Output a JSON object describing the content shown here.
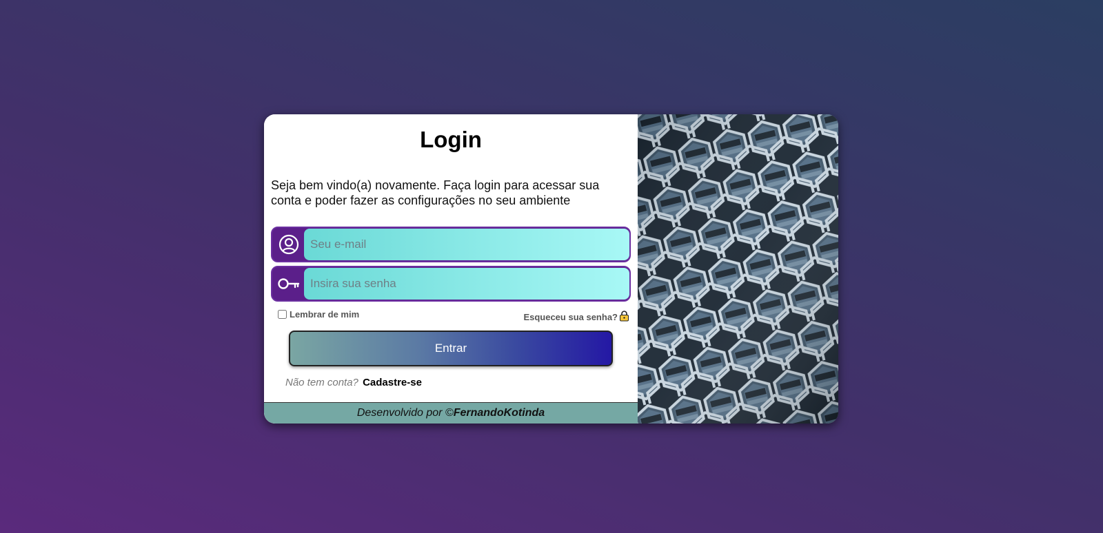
{
  "login": {
    "title": "Login",
    "subtitle": "Seja bem vindo(a) novamente. Faça login para acessar sua conta e poder fazer as configurações no seu ambiente",
    "email_placeholder": "Seu e-mail",
    "password_placeholder": "Insira sua senha",
    "remember_label": "Lembrar de mim",
    "forgot_label": "Esqueceu sua senha?",
    "submit_label": "Entrar",
    "no_account_text": "Não tem conta?",
    "signup_link": "Cadastre-se"
  },
  "footer": {
    "prefix": "Desenvolvido por ©",
    "author": "FernandoKotinda"
  },
  "icons": {
    "email": "user-circle-icon",
    "password": "key-icon",
    "forgot": "lock-icon"
  },
  "colors": {
    "accent_purple": "#5b1f8a",
    "input_gradient_start": "#6ad9d6",
    "input_gradient_end": "#a8f8f6",
    "button_gradient_start": "#7aa6a3",
    "button_gradient_end": "#2418a4",
    "footer_bg": "#75a8a4"
  }
}
